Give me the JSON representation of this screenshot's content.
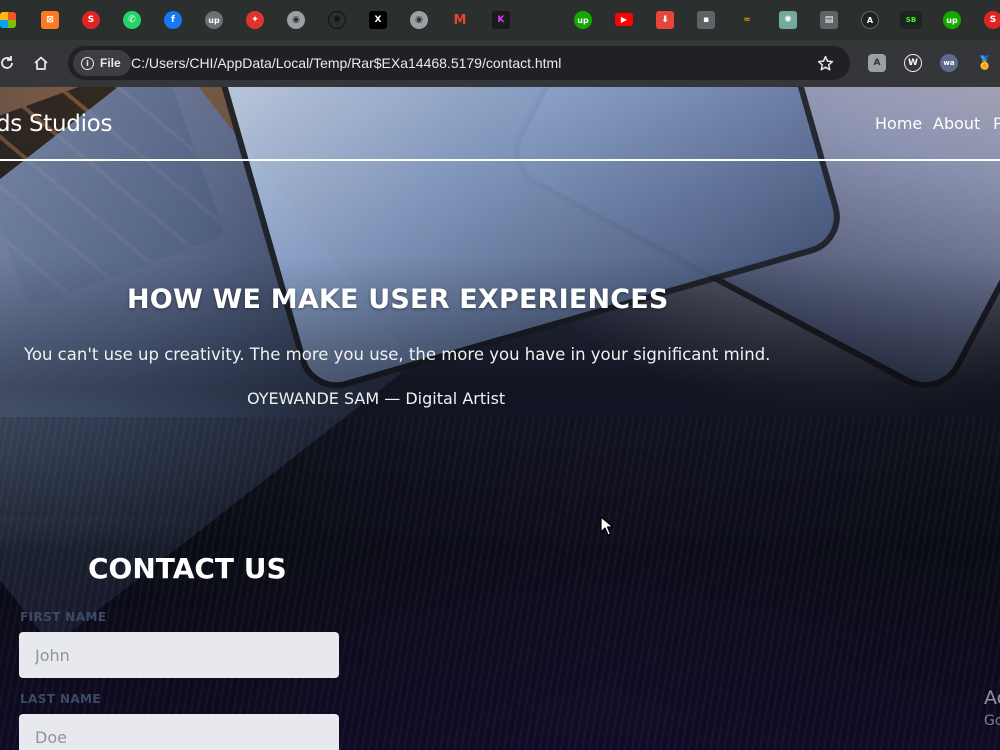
{
  "browser": {
    "bookmarks": [
      {
        "icon": "windows-icon"
      },
      {
        "icon": "xampp-icon",
        "glyph": "⊠",
        "color": "#fb7a24"
      },
      {
        "icon": "s-red-icon",
        "glyph": "S",
        "color": "#e02424"
      },
      {
        "icon": "whatsapp-icon",
        "glyph": "✆",
        "color": "#25d366"
      },
      {
        "icon": "facebook-icon",
        "glyph": "f",
        "color": "#1877f2"
      },
      {
        "icon": "upwork-grey-icon",
        "glyph": "up",
        "color": "#6d6f73"
      },
      {
        "icon": "red-app-icon",
        "glyph": "✦",
        "color": "#e0332f"
      },
      {
        "icon": "globe-icon",
        "glyph": "◉",
        "color": "#9aa0a6"
      },
      {
        "icon": "chatgpt-icon",
        "glyph": "✺",
        "color": "#2b2f2d"
      },
      {
        "icon": "x-icon",
        "glyph": "X",
        "color": "#000000"
      },
      {
        "icon": "globe-icon-2",
        "glyph": "◉",
        "color": "#9aa0a6"
      },
      {
        "icon": "gmail-icon",
        "glyph": "M",
        "color": "#ea4335"
      },
      {
        "icon": "k-icon",
        "glyph": "K",
        "color": "#1a1a1a"
      },
      {
        "icon": "upwork-icon",
        "glyph": "up",
        "color": "#14a800"
      },
      {
        "icon": "youtube-icon",
        "glyph": "▶",
        "color": "#ff0000"
      },
      {
        "icon": "download-icon",
        "glyph": "⬇",
        "color": "#e8453c"
      },
      {
        "icon": "grey-app-icon",
        "glyph": "▪",
        "color": "#5f6368"
      },
      {
        "icon": "orange-app-icon",
        "glyph": "≈",
        "color": "#f29900"
      },
      {
        "icon": "openai-icon",
        "glyph": "✺",
        "color": "#74aa9c"
      },
      {
        "icon": "book-icon",
        "glyph": "▤",
        "color": "#5f6368"
      },
      {
        "icon": "a-logo-icon",
        "glyph": "A",
        "color": "#202124"
      },
      {
        "icon": "slot-bet-icon",
        "glyph": "SB",
        "color": "#202124"
      },
      {
        "icon": "upwork-icon-2",
        "glyph": "up",
        "color": "#14a800"
      },
      {
        "icon": "s-red-icon-2",
        "glyph": "S",
        "color": "#e02424"
      }
    ],
    "address": {
      "scheme_label": "File",
      "url": "C:/Users/CHI/AppData/Local/Temp/Rar$EXa14468.5179/contact.html"
    },
    "accent": "#35363a"
  },
  "site": {
    "brand": "ds Studios",
    "nav": [
      "Home",
      "About",
      "P"
    ]
  },
  "hero": {
    "title": "HOW WE MAKE USER EXPERIENCES",
    "quote": "You can't use up creativity. The more you use, the more you have in your significant mind.",
    "author": "OYEWANDE SAM — Digital Artist"
  },
  "contact": {
    "title": "CONTACT US",
    "first_name": {
      "label": "FIRST NAME",
      "placeholder": "John"
    },
    "last_name": {
      "label": "LAST NAME",
      "placeholder": "Doe"
    }
  },
  "watermark": {
    "line1": "Ac",
    "line2": "Go"
  }
}
